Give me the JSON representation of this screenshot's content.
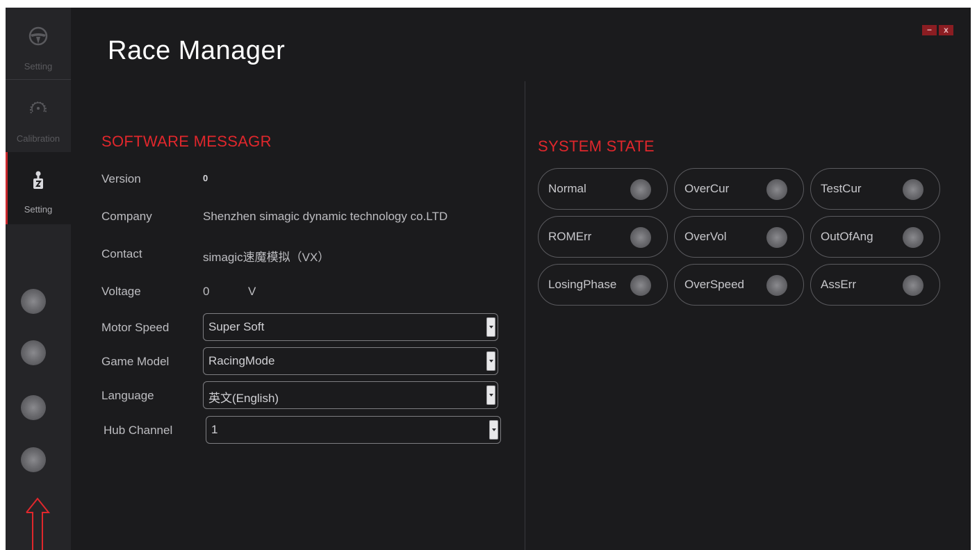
{
  "window": {
    "title": "Race Manager",
    "minimize_label": "−",
    "close_label": "x"
  },
  "sidebar": {
    "items": [
      {
        "label": "Setting",
        "icon": "steering-wheel-icon",
        "active": false
      },
      {
        "label": "Calibration",
        "icon": "gauge-icon",
        "active": false
      },
      {
        "label": "Setting",
        "icon": "gear-shifter-icon",
        "active": true
      }
    ],
    "active_accent": "#c8282d",
    "led_count": 4
  },
  "software": {
    "heading": "SOFTWARE MESSAGR",
    "version_label": "Version",
    "version_value": "0",
    "company_label": "Company",
    "company_value": "Shenzhen simagic dynamic technology co.LTD",
    "contact_label": "Contact",
    "contact_value": "simagic速魔模拟（VX）",
    "voltage_label": "Voltage",
    "voltage_value": "0",
    "voltage_unit": "V",
    "motor_speed_label": "Motor Speed",
    "motor_speed_value": "Super Soft",
    "game_model_label": "Game Model",
    "game_model_value": "RacingMode",
    "language_label": "Language",
    "language_value": "英文(English)",
    "hub_channel_label": "Hub Channel",
    "hub_channel_value": "1"
  },
  "system_state": {
    "heading": "SYSTEM STATE",
    "states": [
      "Normal",
      "OverCur",
      "TestCur",
      "ROMErr",
      "OverVol",
      "OutOfAng",
      "LosingPhase",
      "OverSpeed",
      "AssErr"
    ]
  },
  "colors": {
    "accent_red": "#e0272c",
    "background": "#1b1b1d",
    "sidebar": "#252528"
  }
}
